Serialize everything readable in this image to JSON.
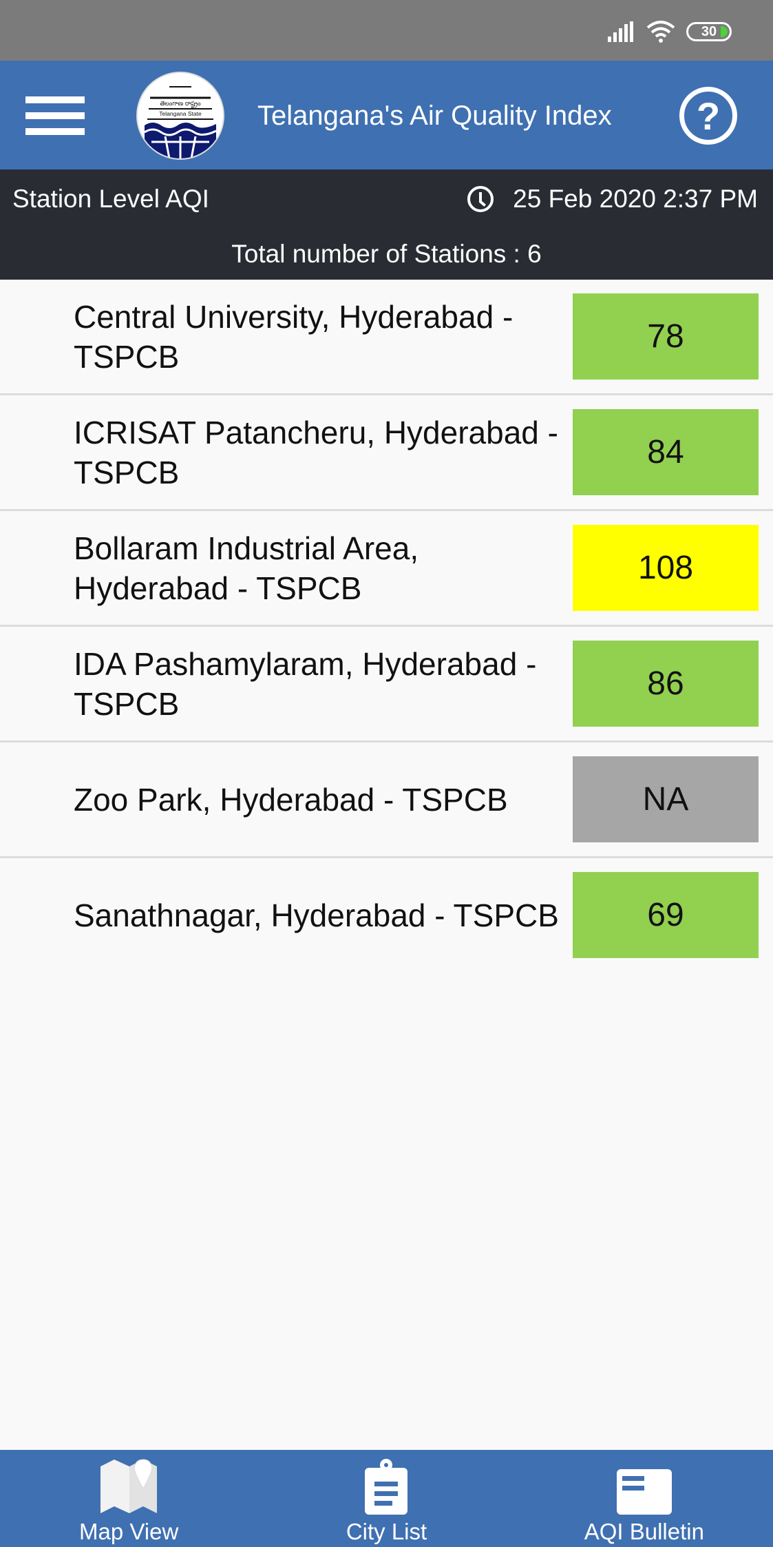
{
  "status_bar": {
    "battery_level": "30",
    "icons": [
      "signal-icon",
      "wifi-icon",
      "battery-icon"
    ]
  },
  "app_bar": {
    "title": "Telangana's Air Quality Index",
    "logo_text_top": "తెలంగాణ రాష్ట్రం",
    "logo_text_bottom": "Telangana State",
    "help_glyph": "?"
  },
  "info_bar": {
    "title": "Station Level AQI",
    "timestamp": "25 Feb 2020 2:37 PM",
    "station_count_text": "Total number of Stations : 6"
  },
  "stations": [
    {
      "name": "Central University, Hyderabad - TSPCB",
      "aqi": "78",
      "color": "#92d050"
    },
    {
      "name": "ICRISAT Patancheru, Hyderabad - TSPCB",
      "aqi": "84",
      "color": "#92d050"
    },
    {
      "name": "Bollaram Industrial Area, Hyderabad - TSPCB",
      "aqi": "108",
      "color": "#ffff00"
    },
    {
      "name": "IDA Pashamylaram, Hyderabad - TSPCB",
      "aqi": "86",
      "color": "#92d050"
    },
    {
      "name": "Zoo Park, Hyderabad - TSPCB",
      "aqi": "NA",
      "color": "#a6a6a6"
    },
    {
      "name": "Sanathnagar, Hyderabad - TSPCB",
      "aqi": "69",
      "color": "#92d050"
    }
  ],
  "bottom_nav": [
    {
      "label": "Map View",
      "icon": "map-icon"
    },
    {
      "label": "City List",
      "icon": "clipboard-list-icon"
    },
    {
      "label": "AQI Bulletin",
      "icon": "bulletin-icon"
    }
  ],
  "colors": {
    "app_bar": "#3f70b1",
    "info_bar": "#292d33",
    "status_bar": "#7b7b7b",
    "good": "#92d050",
    "moderate": "#ffff00",
    "na": "#a6a6a6"
  }
}
